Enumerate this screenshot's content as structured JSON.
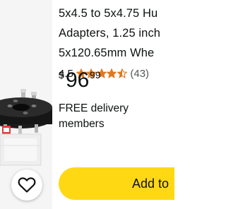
{
  "product": {
    "title_lines": [
      "5x4.5 to 5x4.75 Hu",
      "Adapters, 1.25 inch",
      "5x120.65mm Whe"
    ],
    "rating": "4.5",
    "stars_value": 4.5,
    "stars_max": 5,
    "review_count": "(43)",
    "price": {
      "symbol": "$",
      "whole": "96",
      "fraction": "99"
    },
    "delivery": [
      "FREE delivery",
      "members"
    ],
    "add_button_label": "Add to"
  },
  "colors": {
    "star": "#de7921",
    "button": "#ffd814",
    "text": "#0f1111",
    "muted": "#565959"
  },
  "icons": {
    "wishlist": "heart-outline-icon",
    "star": "star-icon"
  }
}
